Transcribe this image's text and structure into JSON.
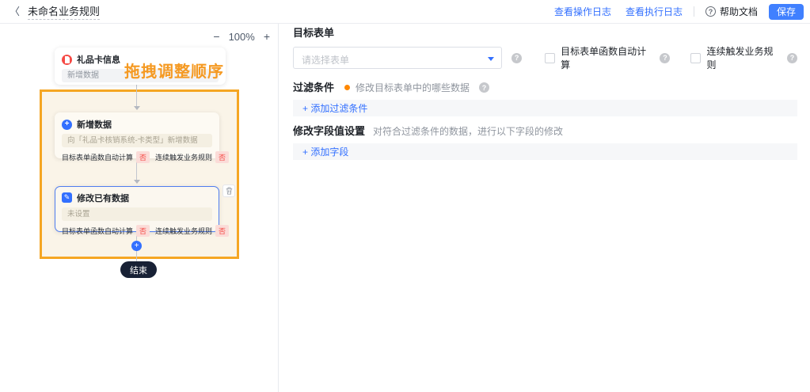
{
  "header": {
    "title": "未命名业务规则",
    "op_log_link": "查看操作日志",
    "exec_log_link": "查看执行日志",
    "help_label": "帮助文档",
    "save_label": "保存"
  },
  "icons": {
    "question_glyph": "?",
    "plus_glyph": "+",
    "pencil_glyph": "✎",
    "back_glyph": "〈",
    "minus_glyph": "−"
  },
  "canvas": {
    "zoom_level": "100%",
    "drag_hint": "拖拽调整顺序",
    "node1": {
      "title": "礼品卡信息",
      "subtitle": "新增数据"
    },
    "node2": {
      "title": "新增数据",
      "desc": "向「礼品卡核销系统-卡类型」新增数据",
      "calc_label": "目标表单函数自动计算",
      "calc_value": "否",
      "trigger_label": "连续触发业务规则",
      "trigger_value": "否"
    },
    "node3": {
      "title": "修改已有数据",
      "desc": "未设置",
      "calc_label": "目标表单函数自动计算",
      "calc_value": "否",
      "trigger_label": "连续触发业务规则",
      "trigger_value": "否"
    },
    "end_label": "结束"
  },
  "panel": {
    "target_form_label": "目标表单",
    "form_placeholder": "请选择表单",
    "checkbox_calc_label": "目标表单函数自动计算",
    "checkbox_trigger_label": "连续触发业务规则",
    "filter_label": "过滤条件",
    "filter_hint": "修改目标表单中的哪些数据",
    "add_filter_link": "+ 添加过滤条件",
    "modify_label": "修改字段值设置",
    "modify_hint": "对符合过滤条件的数据，进行以下字段的修改",
    "add_field_link": "+ 添加字段"
  },
  "colors": {
    "accent_blue": "#3370ff",
    "save_blue": "#4080ff",
    "group_orange": "#f5a623",
    "badge_red": "#f54a45",
    "badge_bg": "#fbdcd8",
    "end_dark": "#182135"
  }
}
